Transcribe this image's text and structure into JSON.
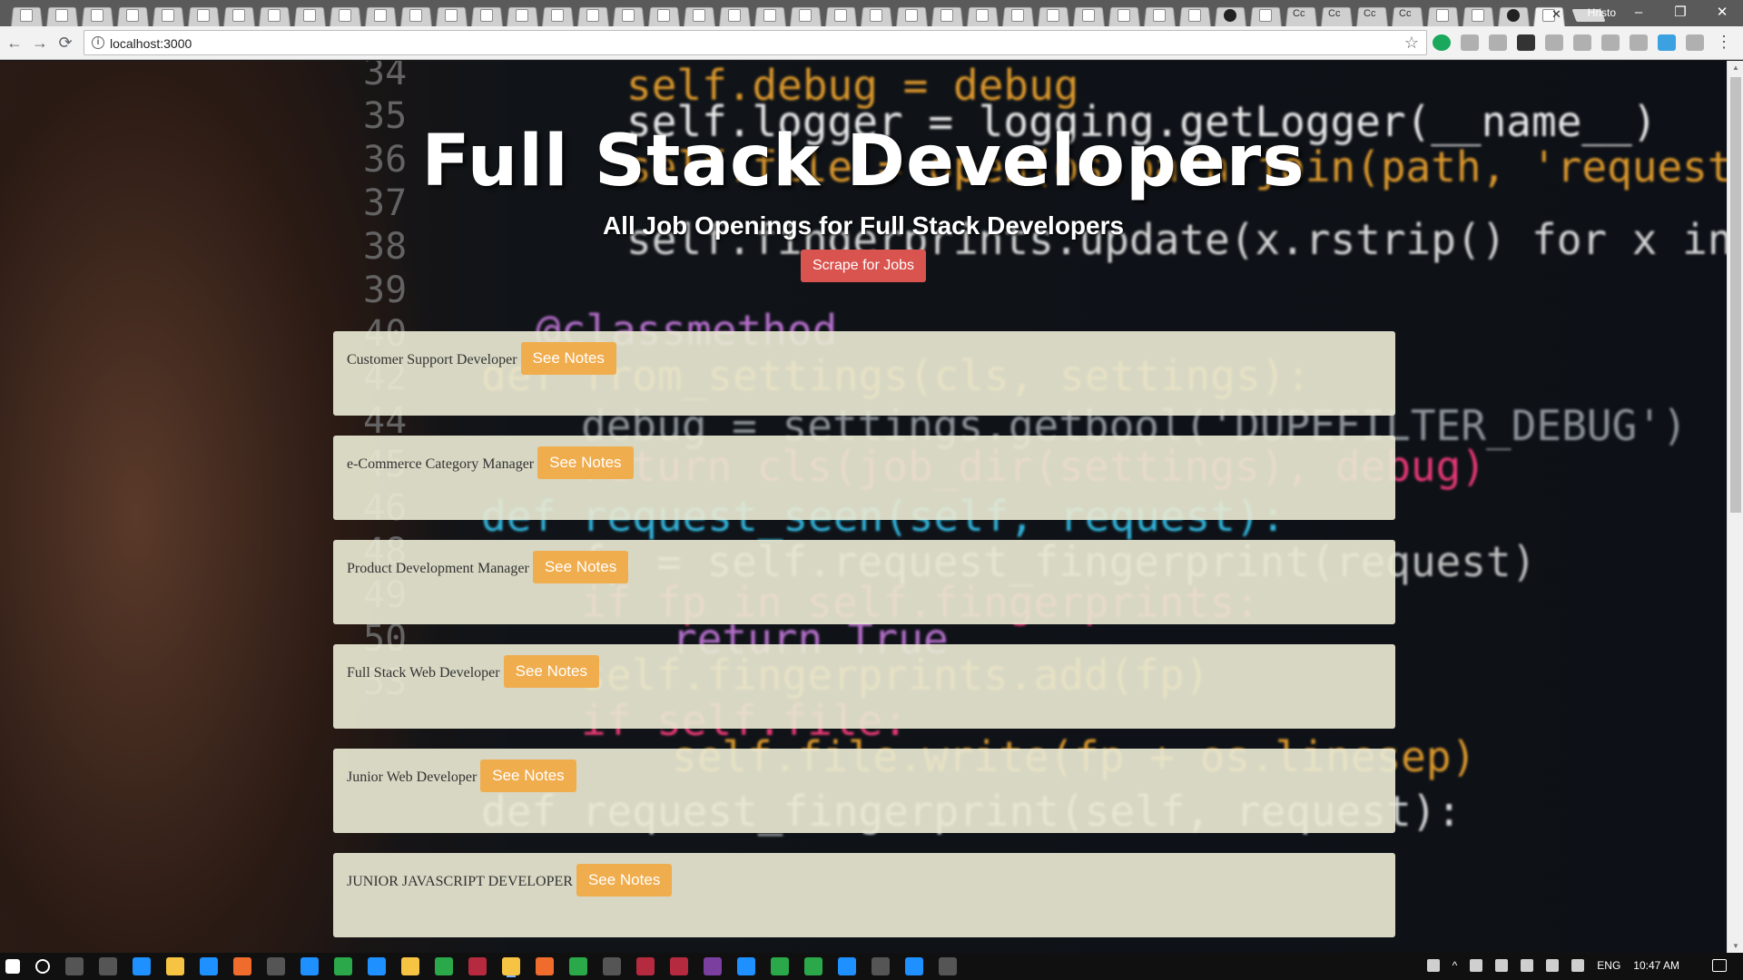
{
  "browser": {
    "url": "localhost:3000",
    "profile_name": "Hristo",
    "window_controls": {
      "minimize": "–",
      "restore": "❐",
      "close": "✕"
    }
  },
  "page": {
    "title": "Full Stack Developers",
    "subtitle": "All Job Openings for Full Stack Developers",
    "scrape_button": "Scrape for Jobs"
  },
  "jobs": [
    {
      "title": "Customer Support Developer",
      "button": "See Notes"
    },
    {
      "title": "e-Commerce Category Manager",
      "button": "See Notes"
    },
    {
      "title": "Product Development Manager",
      "button": "See Notes"
    },
    {
      "title": "Full Stack Web Developer",
      "button": "See Notes"
    },
    {
      "title": "Junior Web Developer",
      "button": "See Notes"
    },
    {
      "title": "JUNIOR JAVASCRIPT DEVELOPER",
      "button": "See Notes"
    }
  ],
  "taskbar": {
    "language": "ENG",
    "time": "10:47 AM"
  },
  "colors": {
    "scrape_button": "#d9534f",
    "notes_button": "#f0ad4e",
    "job_card": "#e8e8d2"
  },
  "background_code": {
    "line_numbers": [
      "34",
      "35",
      "36",
      "37",
      "38",
      "39",
      "40",
      "42",
      "44",
      "45",
      "46",
      "48",
      "49",
      "50",
      "53"
    ],
    "lines": [
      "self.debug = debug",
      "self.logger = logging.getLogger(__name__)",
      "self.file = open(os.path.join(path, 'requests.seen'), 'a+')",
      "self.fingerprints.update(x.rstrip() for x in self.file)",
      "@classmethod",
      "def from_settings(cls, settings):",
      "debug = settings.getbool('DUPEFILTER_DEBUG')",
      "return cls(job_dir(settings), debug)",
      "def request_seen(self, request):",
      "fp = self.request_fingerprint(request)",
      "if fp in self.fingerprints:",
      "return True",
      "self.fingerprints.add(fp)",
      "if self.file:",
      "self.file.write(fp + os.linesep)",
      "def request_fingerprint(self, request):"
    ]
  }
}
